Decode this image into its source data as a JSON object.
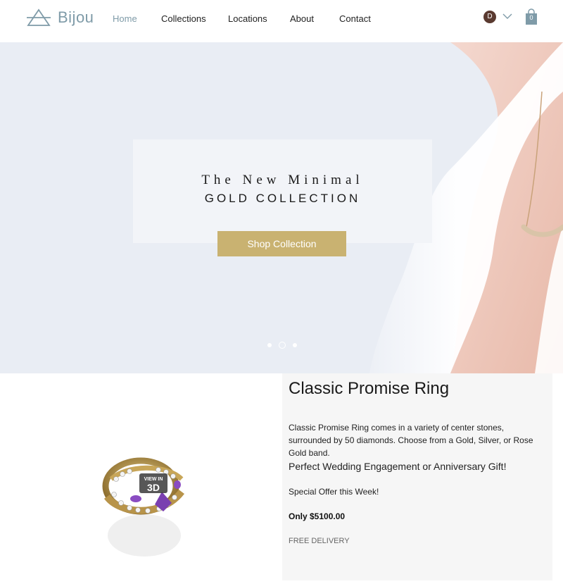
{
  "header": {
    "logo_text": "Bijou",
    "nav": [
      "Home",
      "Collections",
      "Locations",
      "About",
      "Contact"
    ],
    "active_nav": "Home",
    "avatar_initial": "D",
    "cart_count": "0"
  },
  "hero": {
    "line1": "The New Minimal",
    "line2": "GOLD COLLECTION",
    "button": "Shop Collection",
    "slides": 3,
    "active_slide": 2
  },
  "product": {
    "badge": "VIEW IN 3D",
    "title": "Classic Promise Ring",
    "description": "Classic Promise Ring comes in a variety of center stones, surrounded by 50 diamonds. Choose from a Gold, Silver, or Rose Gold band.",
    "subtitle": "Perfect Wedding Engagement or Anniversary Gift!",
    "offer": "Special Offer this Week!",
    "price": "Only $5100.00",
    "delivery": "FREE DELIVERY"
  },
  "colors": {
    "accent": "#7f9ba8",
    "button": "#c9b271",
    "hero_bg": "#e9edf4"
  }
}
